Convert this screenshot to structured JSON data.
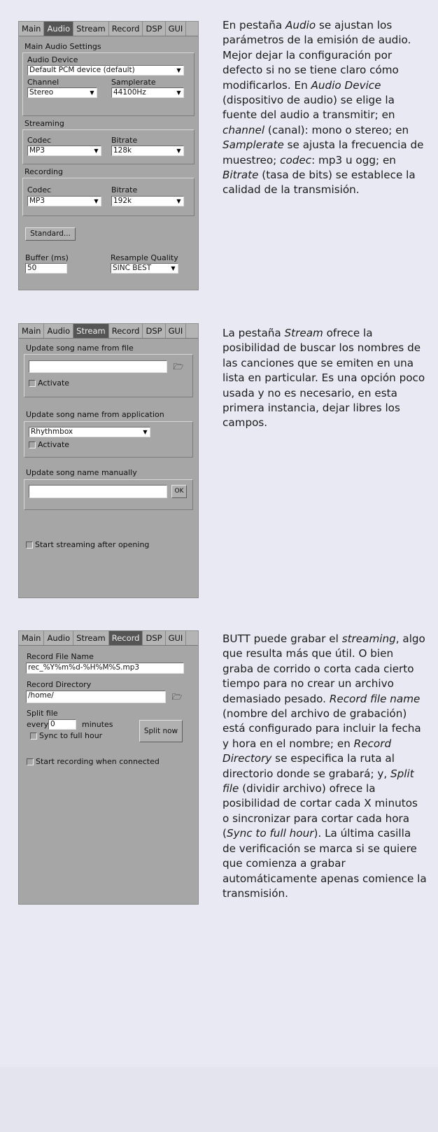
{
  "tabs": [
    "Main",
    "Audio",
    "Stream",
    "Record",
    "DSP",
    "GUI"
  ],
  "audio_panel": {
    "active_tab": "Audio",
    "section_title": "Main Audio Settings",
    "audio_device_label": "Audio Device",
    "audio_device_value": "Default PCM device (default)",
    "channel_label": "Channel",
    "channel_value": "Stereo",
    "samplerate_label": "Samplerate",
    "samplerate_value": "44100Hz",
    "streaming_title": "Streaming",
    "streaming_codec_label": "Codec",
    "streaming_codec_value": "MP3",
    "streaming_bitrate_label": "Bitrate",
    "streaming_bitrate_value": "128k",
    "recording_title": "Recording",
    "recording_codec_label": "Codec",
    "recording_codec_value": "MP3",
    "recording_bitrate_label": "Bitrate",
    "recording_bitrate_value": "192k",
    "standard_button": "Standard...",
    "buffer_label": "Buffer (ms)",
    "buffer_value": "50",
    "resample_label": "Resample Quality",
    "resample_value": "SINC BEST"
  },
  "stream_panel": {
    "active_tab": "Stream",
    "from_file_label": "Update song name from file",
    "from_file_value": "",
    "activate_label_1": "Activate",
    "from_app_label": "Update song name from application",
    "from_app_value": "Rhythmbox",
    "activate_label_2": "Activate",
    "manual_label": "Update song name manually",
    "manual_value": "",
    "ok_button": "OK",
    "start_streaming_label": "Start streaming after opening"
  },
  "record_panel": {
    "active_tab": "Record",
    "file_name_label": "Record File Name",
    "file_name_value": "rec_%Y%m%d-%H%M%S.mp3",
    "directory_label": "Record Directory",
    "directory_value": "/home/",
    "split_file_label": "Split file",
    "every_label": "every",
    "every_value": "0",
    "minutes_label": "minutes",
    "sync_label": "Sync to full hour",
    "split_now_button": "Split now",
    "start_recording_label": "Start recording when connected"
  },
  "text_blocks": {
    "t1": [
      "En pestaña ",
      "Audio",
      " se ajustan los parámetros de la emisión de audio. Mejor dejar la configuración por defecto si no se tiene claro cómo modificarlos. En ",
      "Audio Device",
      " (dispositivo de audio) se elige la fuente del audio a transmitir; en ",
      "channel",
      " (canal): mono o stereo; en ",
      "Samplerate",
      " se ajusta la frecuencia de muestreo; ",
      "codec",
      ": mp3 u ogg; en ",
      "Bitrate",
      " (tasa de bits) se establece la calidad de la transmisión."
    ],
    "t2": [
      "La pestaña ",
      "Stream",
      " ofrece la posibilidad de buscar los nombres de las canciones que se emiten en una lista en particular. Es una opción poco usada y no es necesario, en esta primera instancia, dejar libres los campos."
    ],
    "t3": [
      "BUTT puede grabar el ",
      "streaming",
      ", algo que resulta más que útil. O bien graba de corrido o corta cada cierto tiempo para no crear un archivo demasiado pesado. ",
      "Record file name",
      " (nombre del archivo de grabación) está configurado para incluir la fecha y hora en el nombre; en ",
      "Record Directory",
      " se especifica la ruta al directorio donde se grabará; y, ",
      "Split file",
      " (dividir archivo) ofrece la posibilidad de cortar cada X minutos o sincronizar para cortar cada hora (",
      "Sync to full hour",
      "). La última casilla de verificación se marca si se quiere que comienza a grabar automáticamente apenas comience la transmisión."
    ]
  },
  "colors": {
    "page_bg": "#e9e9f3",
    "panel_bg": "#a6a6a6",
    "active_tab": "#555555",
    "text": "#1a1a1a"
  }
}
